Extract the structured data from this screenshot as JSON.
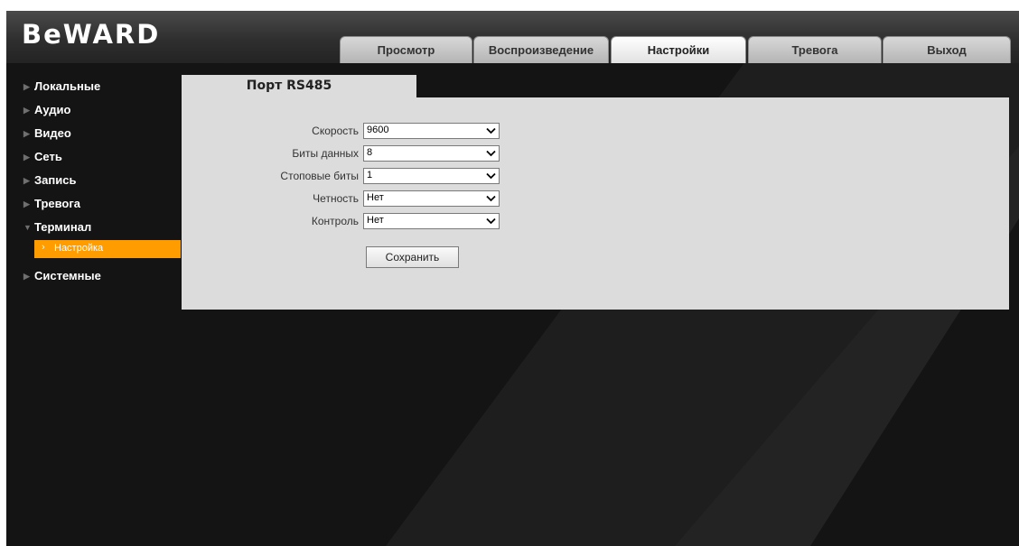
{
  "brand": {
    "logo_text": "BeWARD"
  },
  "nav": {
    "tabs": [
      {
        "label": "Просмотр",
        "active": false
      },
      {
        "label": "Воспроизведение",
        "active": false
      },
      {
        "label": "Настройки",
        "active": true
      },
      {
        "label": "Тревога",
        "active": false
      },
      {
        "label": "Выход",
        "active": false
      }
    ]
  },
  "sidebar": {
    "items": [
      {
        "label": "Локальные",
        "expanded": false
      },
      {
        "label": "Аудио",
        "expanded": false
      },
      {
        "label": "Видео",
        "expanded": false
      },
      {
        "label": "Сеть",
        "expanded": false
      },
      {
        "label": "Запись",
        "expanded": false
      },
      {
        "label": "Тревога",
        "expanded": false
      },
      {
        "label": "Терминал",
        "expanded": true
      },
      {
        "label": "Системные",
        "expanded": false
      }
    ],
    "submenu": {
      "parent": "Терминал",
      "label": "Настройка",
      "selected": true
    }
  },
  "panel": {
    "title": "Порт RS485",
    "fields": [
      {
        "label": "Скорость",
        "value": "9600"
      },
      {
        "label": "Биты данных",
        "value": "8"
      },
      {
        "label": "Стоповые биты",
        "value": "1"
      },
      {
        "label": "Четность",
        "value": "Нет"
      },
      {
        "label": "Контроль",
        "value": "Нет"
      }
    ],
    "save_label": "Сохранить"
  },
  "colors": {
    "background": "#141414",
    "accent": "#ff9c00",
    "panel": "#dcdcdc",
    "watermark": "#2a2a2a"
  }
}
